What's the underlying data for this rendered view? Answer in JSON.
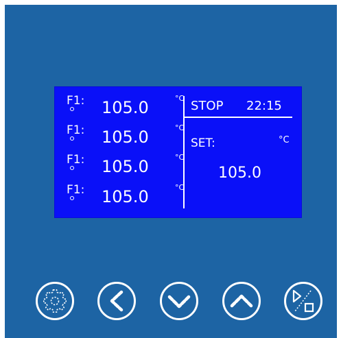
{
  "colors": {
    "panel_background": "#1d64a4",
    "display_background": "#0a10f8",
    "display_text": "#ffffff"
  },
  "display": {
    "channels": [
      {
        "label": "F1:",
        "value": "105.0",
        "unit": "°C"
      },
      {
        "label": "F1:",
        "value": "105.0",
        "unit": "°C"
      },
      {
        "label": "F1:",
        "value": "105.0",
        "unit": "°C"
      },
      {
        "label": "F1:",
        "value": "105.0",
        "unit": "°C"
      }
    ],
    "status": "STOP",
    "time": "22:15",
    "set_label": "SET:",
    "set_unit": "°C",
    "set_value": "105.0"
  },
  "buttons": [
    {
      "name": "settings-button",
      "icon": "gear-icon"
    },
    {
      "name": "left-button",
      "icon": "chevron-left-icon"
    },
    {
      "name": "down-button",
      "icon": "chevron-down-icon"
    },
    {
      "name": "up-button",
      "icon": "chevron-up-icon"
    },
    {
      "name": "start-stop-button",
      "icon": "play-stop-icon"
    }
  ]
}
